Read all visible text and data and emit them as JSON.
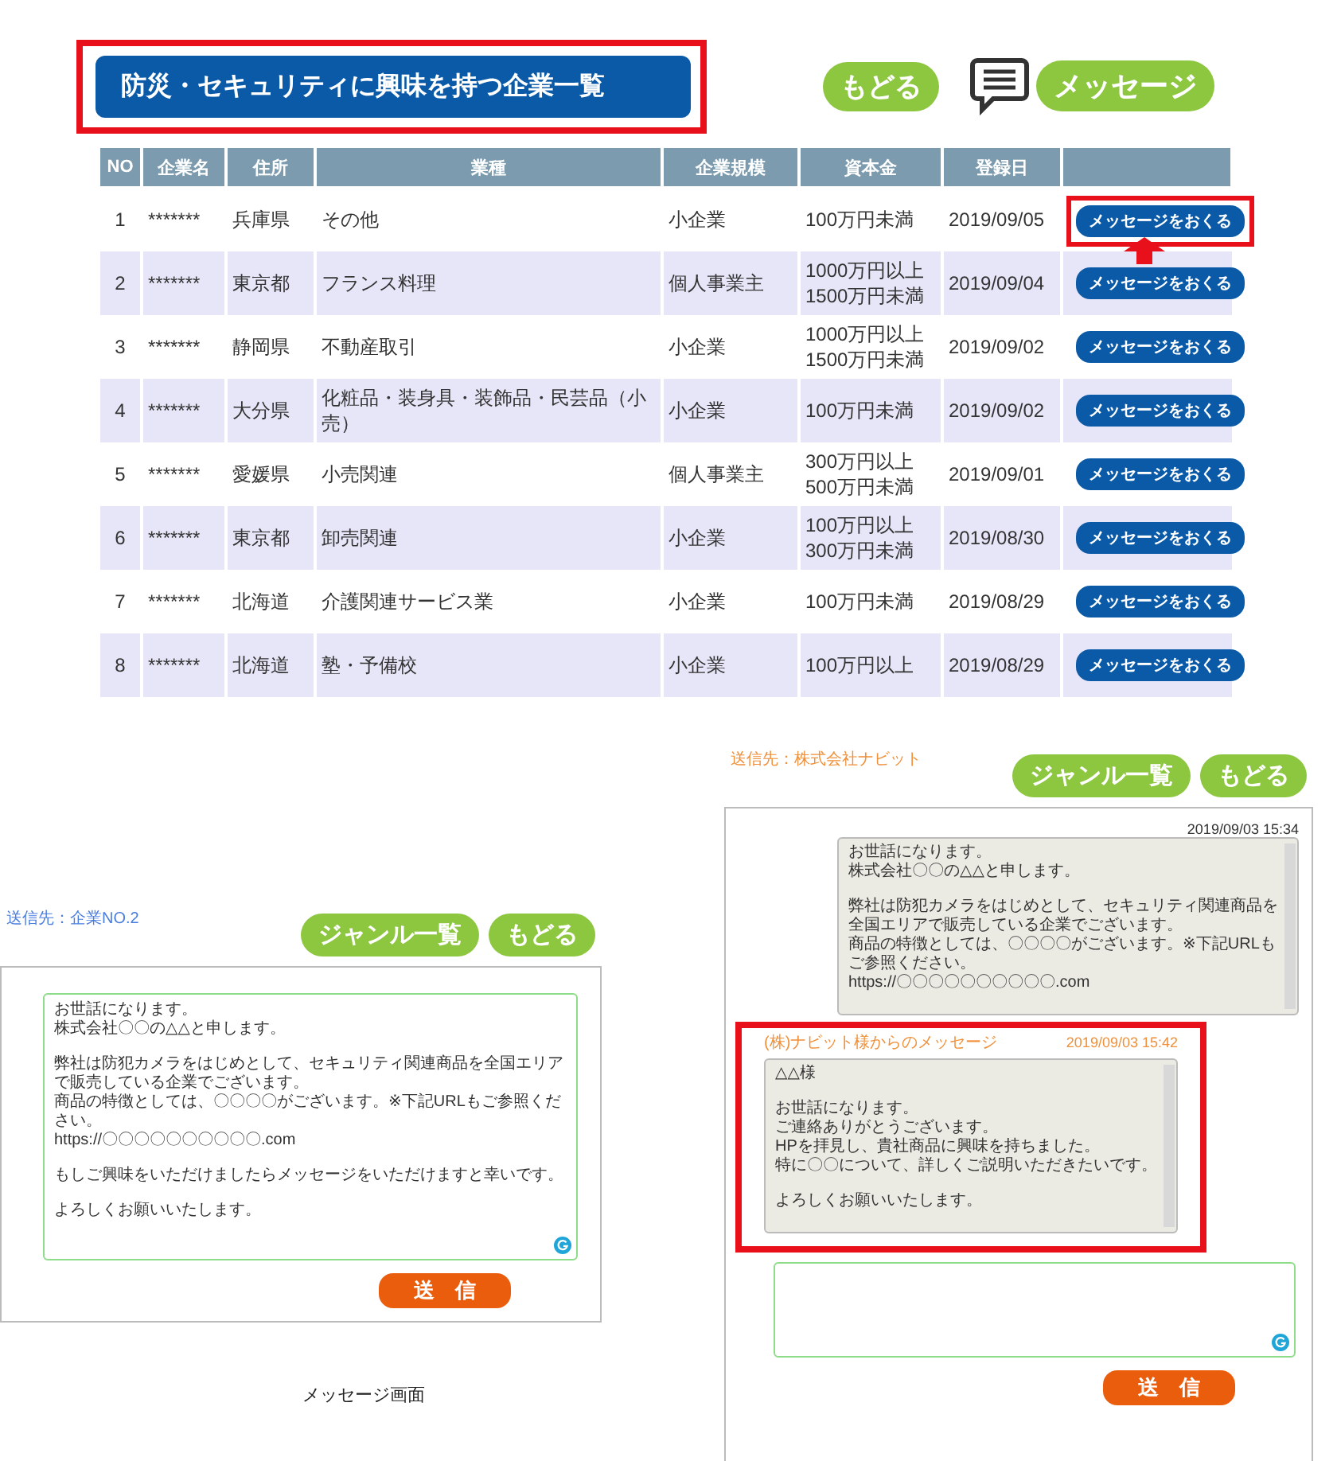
{
  "header": {
    "title": "防災・セキュリティに興味を持つ企業一覧",
    "title_highlighted": true,
    "back_button": "もどる",
    "message_button": "メッセージ"
  },
  "table": {
    "columns": [
      "NO",
      "企業名",
      "住所",
      "業種",
      "企業規模",
      "資本金",
      "登録日"
    ],
    "rows": [
      {
        "no": "1",
        "company": "*******",
        "address": "兵庫県",
        "industry": "その他",
        "size": "小企業",
        "capital": "100万円未満",
        "registered": "2019/09/05",
        "action": "メッセージをおくる",
        "highlighted": true
      },
      {
        "no": "2",
        "company": "*******",
        "address": "東京都",
        "industry": "フランス料理",
        "size": "個人事業主",
        "capital": "1000万円以上\n1500万円未満",
        "registered": "2019/09/04",
        "action": "メッセージをおくる",
        "highlighted": false
      },
      {
        "no": "3",
        "company": "*******",
        "address": "静岡県",
        "industry": "不動産取引",
        "size": "小企業",
        "capital": "1000万円以上\n1500万円未満",
        "registered": "2019/09/02",
        "action": "メッセージをおくる",
        "highlighted": false
      },
      {
        "no": "4",
        "company": "*******",
        "address": "大分県",
        "industry": "化粧品・装身具・装飾品・民芸品（小売）",
        "size": "小企業",
        "capital": "100万円未満",
        "registered": "2019/09/02",
        "action": "メッセージをおくる",
        "highlighted": false
      },
      {
        "no": "5",
        "company": "*******",
        "address": "愛媛県",
        "industry": "小売関連",
        "size": "個人事業主",
        "capital": "300万円以上\n500万円未満",
        "registered": "2019/09/01",
        "action": "メッセージをおくる",
        "highlighted": false
      },
      {
        "no": "6",
        "company": "*******",
        "address": "東京都",
        "industry": "卸売関連",
        "size": "小企業",
        "capital": "100万円以上\n300万円未満",
        "registered": "2019/08/30",
        "action": "メッセージをおくる",
        "highlighted": false
      },
      {
        "no": "7",
        "company": "*******",
        "address": "北海道",
        "industry": "介護関連サービス業",
        "size": "小企業",
        "capital": "100万円未満",
        "registered": "2019/08/29",
        "action": "メッセージをおくる",
        "highlighted": false
      },
      {
        "no": "8",
        "company": "*******",
        "address": "北海道",
        "industry": "塾・予備校",
        "size": "小企業",
        "capital": "100万円以上",
        "registered": "2019/08/29",
        "action": "メッセージをおくる",
        "highlighted": false
      }
    ]
  },
  "compose": {
    "recipient": "送信先：企業NO.2",
    "genre_button": "ジャンル一覧",
    "back_button": "もどる",
    "paragraphs": [
      [
        "お世話になります。",
        "株式会社〇〇の△△と申します。"
      ],
      [
        "弊社は防犯カメラをはじめとして、セキュリティ関連商品を全国エリアで販売している企業でございます。",
        "商品の特徴としては、〇〇〇〇がございます。※下記URLもご参照ください。",
        "https://〇〇〇〇〇〇〇〇〇〇.com"
      ],
      [
        "もしご興味をいただけましたらメッセージをいただけますと幸いです。"
      ],
      [
        "よろしくお願いいたします。"
      ]
    ],
    "send_button": "送　信"
  },
  "thread": {
    "recipient": "送信先：株式会社ナビット",
    "genre_button": "ジャンル一覧",
    "back_button": "もどる",
    "messages": [
      {
        "kind": "sent",
        "time": "2019/09/03 15:34",
        "highlighted": false,
        "paragraphs": [
          [
            "お世話になります。",
            "株式会社〇〇の△△と申します。"
          ],
          [
            "弊社は防犯カメラをはじめとして、セキュリティ関連商品を",
            "全国エリアで販売している企業でございます。",
            "商品の特徴としては、〇〇〇〇がございます。※下記URLも",
            "ご参照ください。",
            "https://〇〇〇〇〇〇〇〇〇〇.com"
          ]
        ]
      },
      {
        "kind": "received",
        "sender": "(株)ナビット様からのメッセージ",
        "time": "2019/09/03 15:42",
        "highlighted": true,
        "paragraphs": [
          [
            "△△様"
          ],
          [
            "お世話になります。",
            "ご連絡ありがとうございます。",
            "HPを拝見し、貴社商品に興味を持ちました。",
            "特に〇〇について、詳しくご説明いただきたいです。"
          ],
          [
            "よろしくお願いいたします。"
          ]
        ]
      }
    ],
    "send_button": "送　信"
  },
  "caption": "メッセージ画面"
}
